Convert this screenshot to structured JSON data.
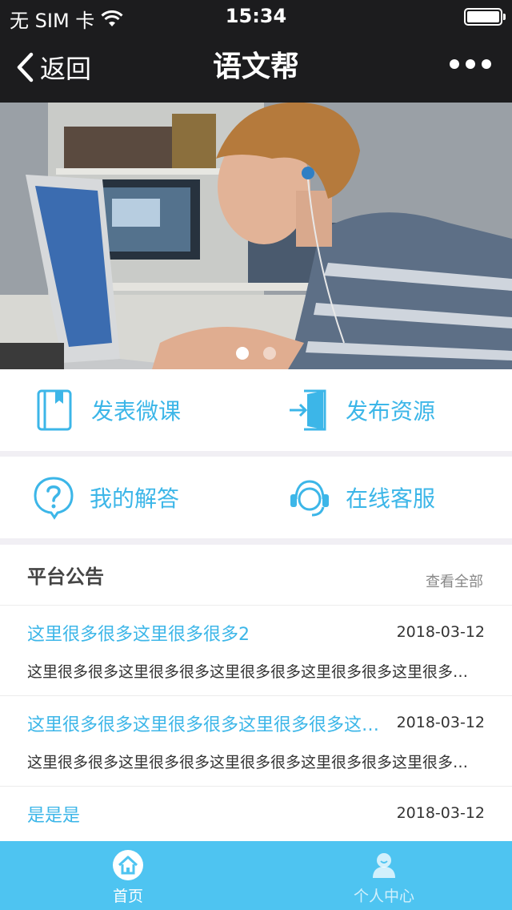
{
  "status_bar": {
    "carrier": "无 SIM 卡",
    "time": "15:34"
  },
  "nav": {
    "back_label": "返回",
    "title": "语文帮"
  },
  "banner": {
    "slide_count": 2,
    "active_index": 0
  },
  "actions": [
    {
      "label": "发表微课",
      "icon": "book-icon"
    },
    {
      "label": "发布资源",
      "icon": "door-enter-icon"
    },
    {
      "label": "我的解答",
      "icon": "question-bubble-icon"
    },
    {
      "label": "在线客服",
      "icon": "headset-icon"
    }
  ],
  "notices": {
    "title": "平台公告",
    "view_all": "查看全部",
    "items": [
      {
        "title": "这里很多很多这里很多很多2",
        "date": "2018-03-12",
        "desc": "这里很多很多这里很多很多这里很多很多这里很多很多这里很多很多这里很多很多这里很多很多"
      },
      {
        "title": "这里很多很多这里很多很多这里很多很多这里很多很多这里很多很多",
        "date": "2018-03-12",
        "desc": "这里很多很多这里很多很多这里很多很多这里很多很多这里很多很多这里很多很多这里很多很多"
      },
      {
        "title": "是是是",
        "date": "2018-03-12",
        "desc": ""
      }
    ]
  },
  "tabs": [
    {
      "label": "首页",
      "icon": "home-icon",
      "active": true
    },
    {
      "label": "个人中心",
      "icon": "user-icon",
      "active": false
    }
  ],
  "colors": {
    "accent": "#3cb6e8",
    "tab_bar": "#4ec4f1",
    "nav_bg": "#1c1c1e",
    "divider": "#f1eff4"
  }
}
